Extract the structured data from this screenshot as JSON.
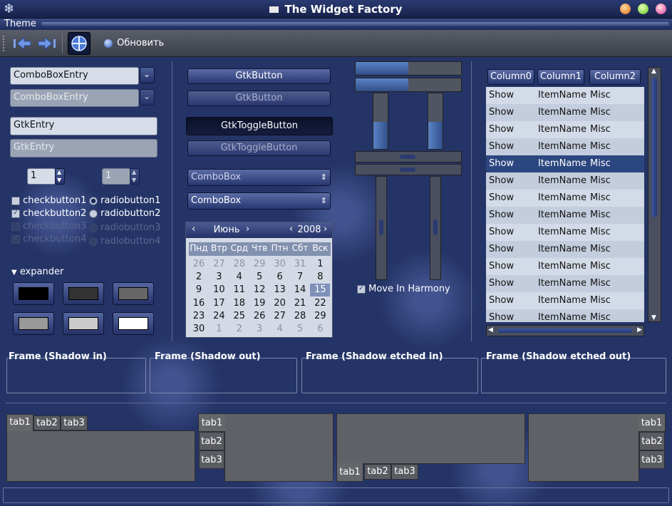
{
  "window": {
    "title": "The Widget Factory"
  },
  "menu": {
    "items": [
      "Theme"
    ]
  },
  "toolbar": {
    "refresh_label": "Обновить"
  },
  "left": {
    "combo_entry_1": "ComboBoxEntry",
    "combo_entry_2": "ComboBoxEntry",
    "entry_1": "GtkEntry",
    "entry_2": "GtkEntry",
    "spin_1": "1",
    "spin_2": "1",
    "checks": [
      "checkbutton1",
      "checkbutton2",
      "checkbutton3",
      "checkbutton4"
    ],
    "radios": [
      "radiobutton1",
      "radiobutton2",
      "radiobutton3",
      "radiobutton4"
    ],
    "expander": "expander",
    "swatches": [
      "#000000",
      "#333333",
      "#666666",
      "#999999",
      "#cccccc",
      "#ffffff"
    ]
  },
  "center": {
    "button_1": "GtkButton",
    "button_2": "GtkButton",
    "toggle_1": "GtkToggleButton",
    "toggle_2": "GtkToggleButton",
    "combo_1": "ComboBox",
    "combo_2": "ComboBox"
  },
  "calendar": {
    "month": "Июнь",
    "year": "2008",
    "weekdays": [
      "Пнд",
      "Втр",
      "Срд",
      "Чтв",
      "Птн",
      "Сбт",
      "Вск"
    ],
    "weeks": [
      [
        "26",
        "27",
        "28",
        "29",
        "30",
        "31",
        "1"
      ],
      [
        "2",
        "3",
        "4",
        "5",
        "6",
        "7",
        "8"
      ],
      [
        "9",
        "10",
        "11",
        "12",
        "13",
        "14",
        "15"
      ],
      [
        "16",
        "17",
        "18",
        "19",
        "20",
        "21",
        "22"
      ],
      [
        "23",
        "24",
        "25",
        "26",
        "27",
        "28",
        "29"
      ],
      [
        "30",
        "1",
        "2",
        "3",
        "4",
        "5",
        "6"
      ]
    ],
    "selected": "15"
  },
  "sliders": {
    "harmony_label": "Move In Harmony"
  },
  "tree": {
    "columns": [
      "Column0",
      "Column1",
      "Column2"
    ],
    "rows": [
      [
        "Show",
        "ItemName",
        "Misc"
      ],
      [
        "Show",
        "ItemName",
        "Misc"
      ],
      [
        "Show",
        "ItemName",
        "Misc"
      ],
      [
        "Show",
        "ItemName",
        "Misc"
      ],
      [
        "Show",
        "ItemName",
        "Misc"
      ],
      [
        "Show",
        "ItemName",
        "Misc"
      ],
      [
        "Show",
        "ItemName",
        "Misc"
      ],
      [
        "Show",
        "ItemName",
        "Misc"
      ],
      [
        "Show",
        "ItemName",
        "Misc"
      ],
      [
        "Show",
        "ItemName",
        "Misc"
      ],
      [
        "Show",
        "ItemName",
        "Misc"
      ],
      [
        "Show",
        "ItemName",
        "Misc"
      ],
      [
        "Show",
        "ItemName",
        "Misc"
      ],
      [
        "Show",
        "ItemName",
        "Misc"
      ]
    ],
    "selected_row": 4
  },
  "frames": [
    "Frame (Shadow in)",
    "Frame (Shadow out)",
    "Frame (Shadow etched in)",
    "Frame (Shadow etched out)"
  ],
  "notebooks": {
    "tabs": [
      "tab1",
      "tab2",
      "tab3"
    ]
  },
  "colors": {
    "accent": "#243466",
    "selection": "#2c4680"
  }
}
